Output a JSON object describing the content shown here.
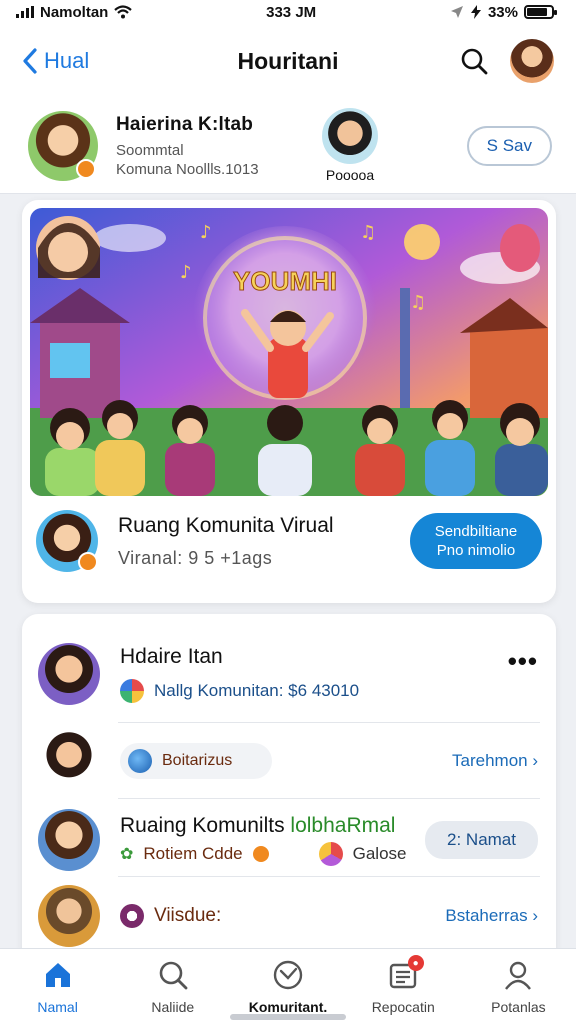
{
  "status_bar": {
    "carrier": "Namoltan",
    "time": "333 JM",
    "battery": "33%",
    "battery_level": 0.85
  },
  "nav": {
    "back_label": "Hual",
    "title": "Houritani"
  },
  "profile": {
    "name": "Haierina K:ltab",
    "subtitle": "Soommtal",
    "subtitle2": "Komuna Noollls.1013",
    "friend_label": "Pooooa",
    "save_label": "S Sav"
  },
  "hero": {
    "banner_text": "YOUMHI",
    "title": "Ruang Komunita Virual",
    "subtitle": "Viranal: 9 5 +1ags",
    "join_label_line1": "Sendbiltiane",
    "join_label_line2": "Pno nimolio"
  },
  "list": {
    "item1": {
      "title": "Hdaire Itan",
      "sub": "Nallg Komunitan: $6 43010",
      "more": "•••"
    },
    "item2": {
      "sub": "Boitarizus",
      "link": "Tarehmon ›"
    },
    "item3": {
      "title_a": "Ruaing Komunilts ",
      "title_b": "lolbhaRmal",
      "sub_a": "Rotiem Cdde",
      "sub_b": "Galose",
      "button": "2: Namat"
    },
    "item4": {
      "sub": "Viisdue:",
      "link": "Bstaherras ›"
    }
  },
  "tabs": [
    {
      "label": "Namal",
      "icon": "home-icon"
    },
    {
      "label": "Naliide",
      "icon": "search-icon"
    },
    {
      "label": "Komuritant.",
      "icon": "community-icon"
    },
    {
      "label": "Repocatin",
      "icon": "report-icon"
    },
    {
      "label": "Potanlas",
      "icon": "profile-icon"
    }
  ],
  "colors": {
    "accent": "#1a73d9",
    "button_blue": "#1586d6",
    "brown_text": "#6a2b0f",
    "green_text": "#2a8b2a"
  }
}
